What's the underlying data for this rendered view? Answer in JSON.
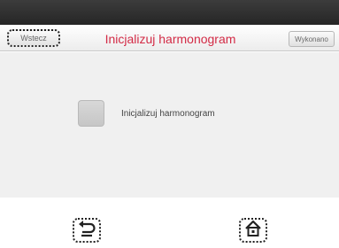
{
  "header": {
    "back_label": "Wstecz",
    "title": "Inicjalizuj harmonogram",
    "done_label": "Wykonano"
  },
  "main": {
    "option_label": "Inicjalizuj harmonogram",
    "option_checked": false
  },
  "footer": {
    "back_icon": "back-arrow-icon",
    "home_icon": "home-icon"
  },
  "colors": {
    "title": "#d32b46",
    "status_bar": "#2e2e2e",
    "content_bg": "#f0f0f0"
  }
}
